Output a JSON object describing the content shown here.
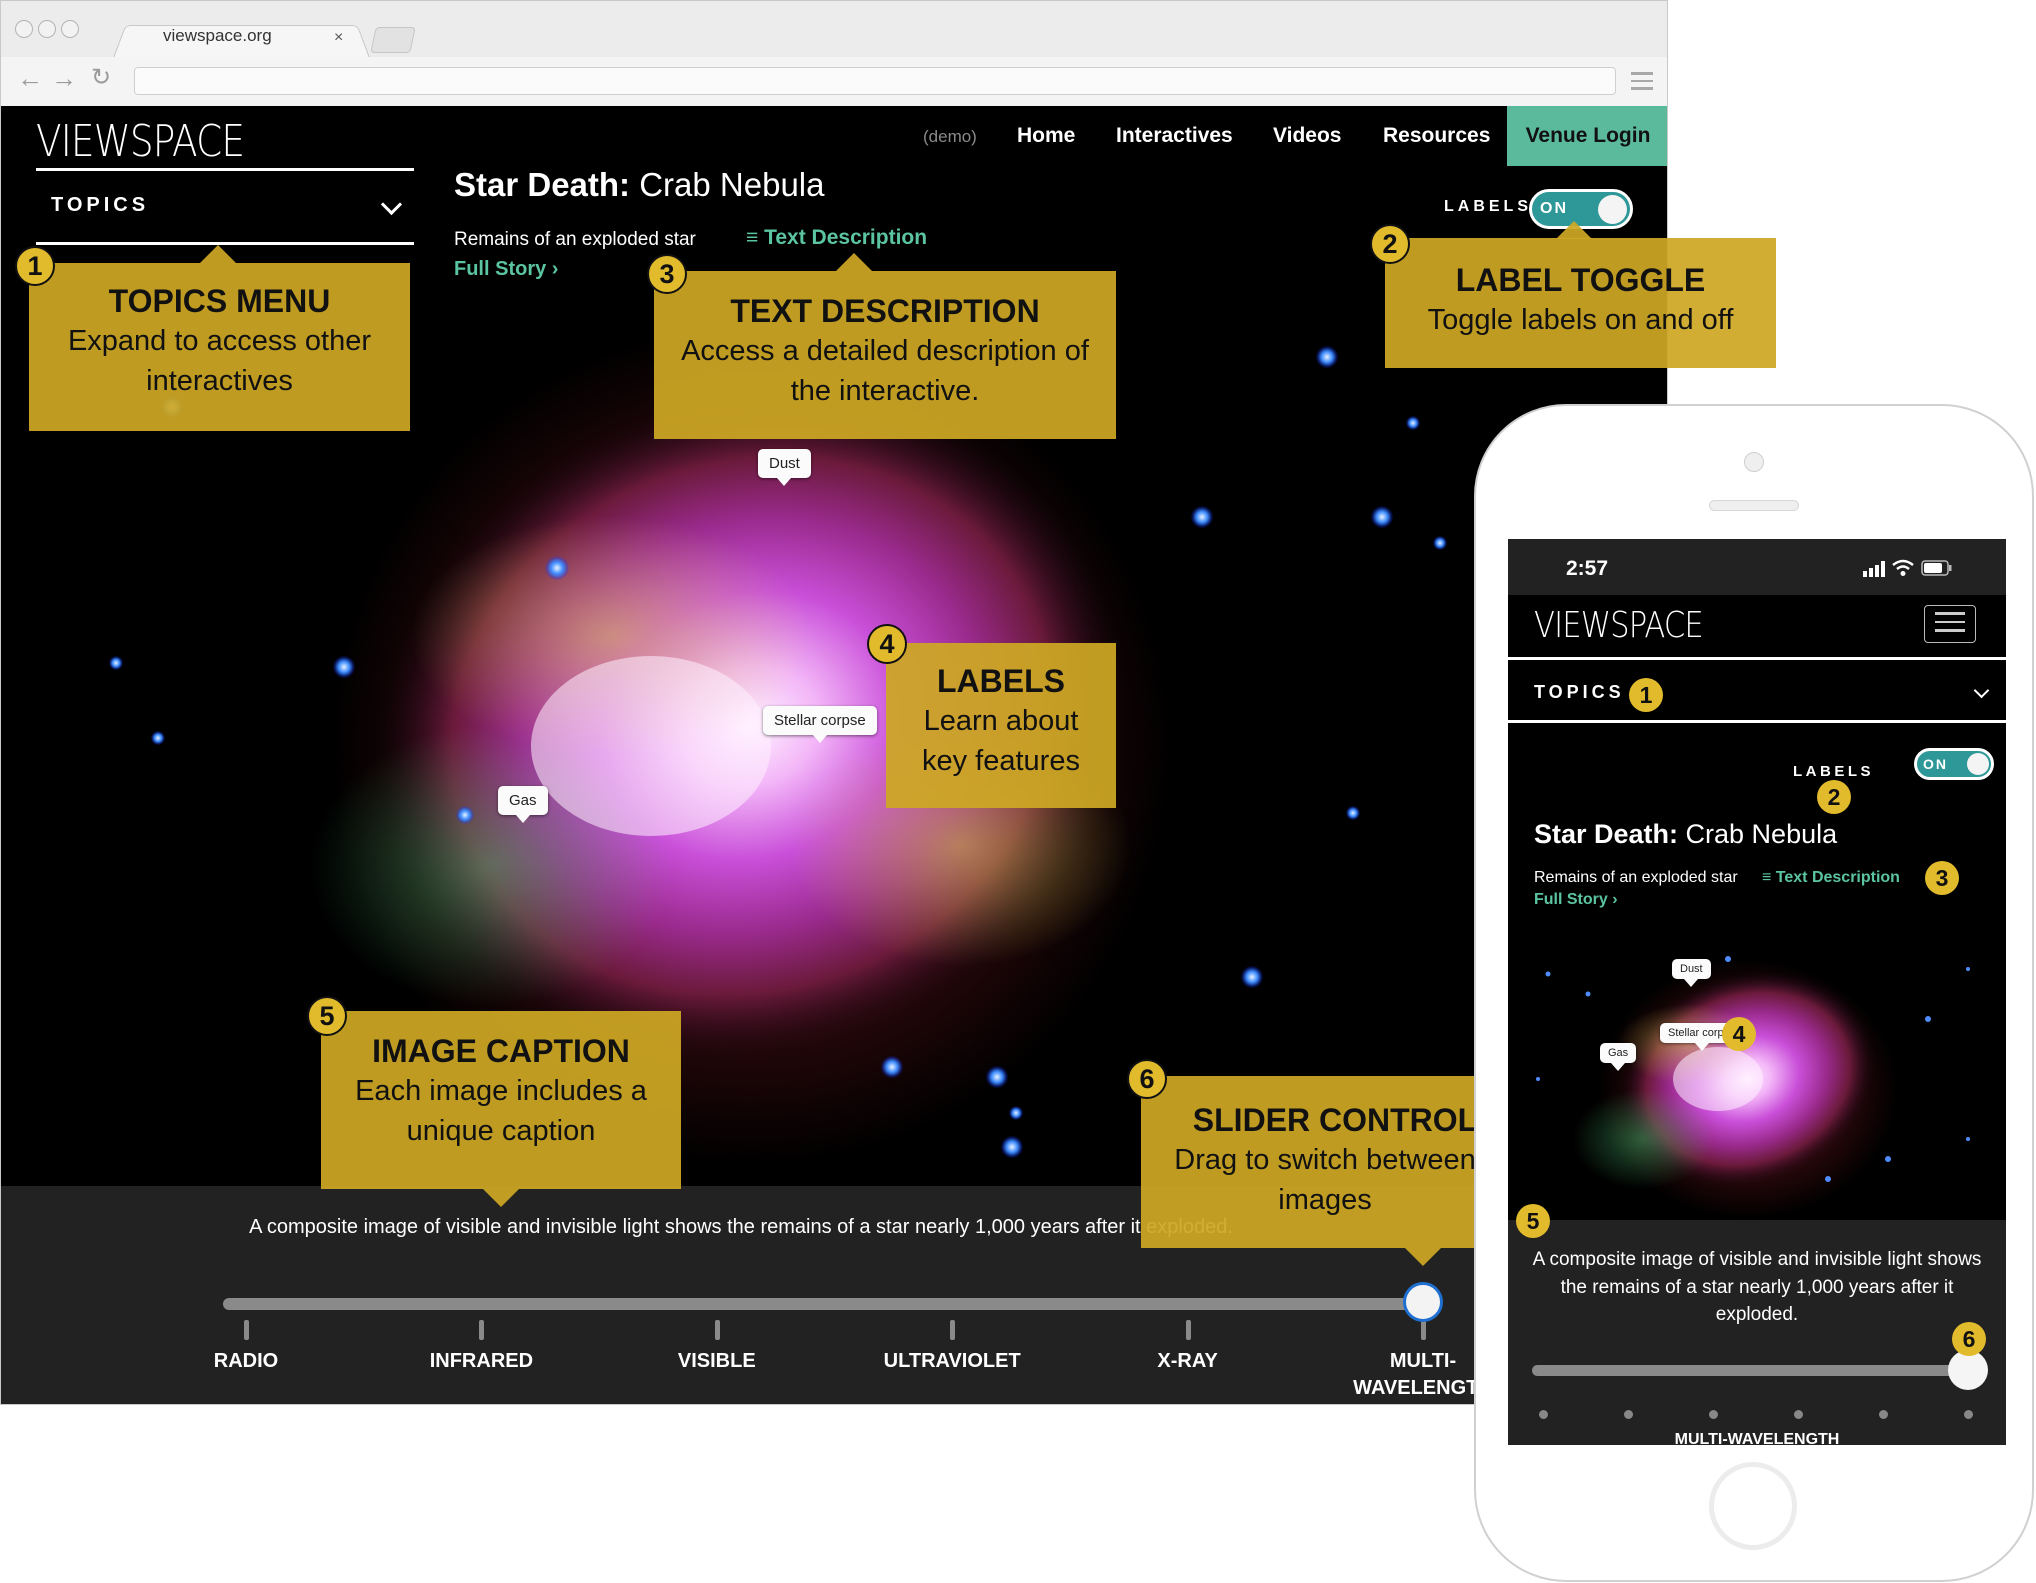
{
  "browser": {
    "tab_title": "viewspace.org",
    "tab_close": "×",
    "url": ""
  },
  "header": {
    "logo": "VIEWSPACE",
    "demo": "(demo)",
    "nav": [
      "Home",
      "Interactives",
      "Videos",
      "Resources"
    ],
    "venue_login": "Venue Login"
  },
  "topics": {
    "label": "TOPICS"
  },
  "interactive": {
    "title_bold": "Star Death:",
    "title_rest": " Crab Nebula",
    "subtitle": "Remains of an exploded star",
    "text_description": "Text Description",
    "full_story": "Full Story",
    "labels_toggle": {
      "label": "LABELS",
      "state": "ON",
      "on": true
    },
    "image_labels": [
      "Dust",
      "Stellar corpse",
      "Gas"
    ],
    "caption": "A composite image of visible and invisible light shows the remains of a star nearly 1,000 years after it exploded.",
    "slider": {
      "stops": [
        "RADIO",
        "INFRARED",
        "VISIBLE",
        "ULTRAVIOLET",
        "X-RAY",
        "MULTI-\nWAVELENGTH"
      ],
      "selected_index": 5,
      "selected_label": "MULTI-WAVELENGTH"
    }
  },
  "callouts": [
    {
      "number": "1",
      "title": "TOPICS MENU",
      "body": "Expand to access other interactives"
    },
    {
      "number": "2",
      "title": "LABEL TOGGLE",
      "body": "Toggle labels on and off"
    },
    {
      "number": "3",
      "title": "TEXT DESCRIPTION",
      "body": "Access a detailed description of the interactive."
    },
    {
      "number": "4",
      "title": "LABELS",
      "body": "Learn about key features"
    },
    {
      "number": "5",
      "title": "IMAGE CAPTION",
      "body": "Each image includes a unique caption"
    },
    {
      "number": "6",
      "title": "SLIDER CONTROL",
      "body": "Drag to switch between images"
    }
  ],
  "phone": {
    "time": "2:57",
    "logo": "VIEWSPACE",
    "topics": "TOPICS",
    "labels": "LABELS",
    "labels_state": "ON",
    "title_bold": "Star Death:",
    "title_rest": " Crab Nebula",
    "subtitle": "Remains of an exploded star",
    "text_description": "Text Description",
    "full_story": "Full Story",
    "image_labels": [
      "Dust",
      "Stellar corpse",
      "Gas"
    ],
    "caption": "A composite image of visible and invisible light shows the remains of a star nearly 1,000 years after it exploded.",
    "slider_selected_label": "MULTI-WAVELENGTH",
    "slider_stop_count": 6,
    "slider_selected_index": 5,
    "badges": [
      "1",
      "2",
      "3",
      "4",
      "5",
      "6"
    ]
  },
  "colors": {
    "accent_teal": "#5bc4a0",
    "venue_login_bg": "#5bba9c",
    "toggle_bg": "#2e9797",
    "callout_gold": "#cda824",
    "badge_gold": "#e2bb2c",
    "caption_panel": "#222222",
    "slider_thumb_ring": "#1f6fd0"
  }
}
